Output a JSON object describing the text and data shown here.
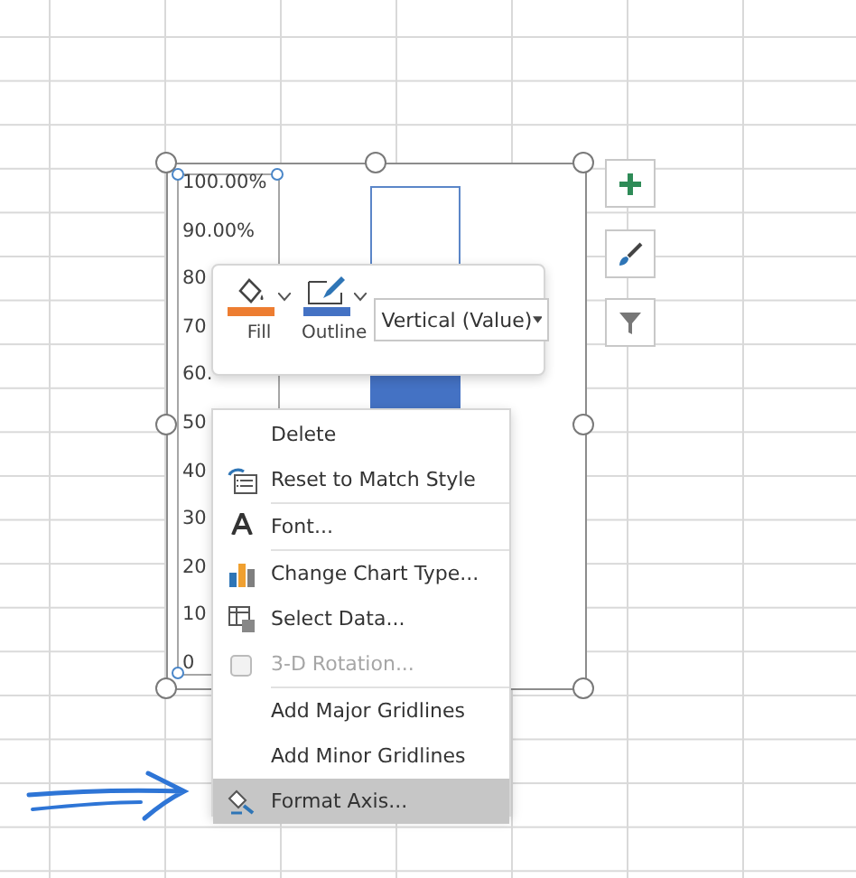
{
  "chart": {
    "axis_labels": [
      {
        "text": "100.00%"
      },
      {
        "text": "90.00%"
      },
      {
        "text": "80"
      },
      {
        "text": "70"
      },
      {
        "text": "60."
      },
      {
        "text": "50"
      },
      {
        "text": "40"
      },
      {
        "text": "30"
      },
      {
        "text": "20"
      },
      {
        "text": "10"
      },
      {
        "text": "0"
      }
    ]
  },
  "mini_toolbar": {
    "buttons": [
      {
        "label": "Fill",
        "color": "#ed7d31"
      },
      {
        "label": "Outline",
        "color": "#4472c4"
      }
    ],
    "dropdown": "Vertical (Value)"
  },
  "context_menu": [
    {
      "label": "Delete",
      "kind": "plain",
      "disabled": false,
      "selected": false,
      "separator_before": false
    },
    {
      "label": "Reset to Match Style",
      "kind": "reset",
      "disabled": false,
      "selected": false,
      "separator_before": false
    },
    {
      "label": "Font...",
      "kind": "font",
      "disabled": false,
      "selected": false,
      "separator_before": true
    },
    {
      "label": "Change Chart Type...",
      "kind": "chart",
      "disabled": false,
      "selected": false,
      "separator_before": true
    },
    {
      "label": "Select Data...",
      "kind": "data",
      "disabled": false,
      "selected": false,
      "separator_before": false
    },
    {
      "label": "3-D Rotation...",
      "kind": "rotation",
      "disabled": true,
      "selected": false,
      "separator_before": false
    },
    {
      "label": "Add Major Gridlines",
      "kind": "plain",
      "disabled": false,
      "selected": false,
      "separator_before": true
    },
    {
      "label": "Add Minor Gridlines",
      "kind": "plain",
      "disabled": false,
      "selected": false,
      "separator_before": false
    },
    {
      "label": "Format Axis...",
      "kind": "format",
      "disabled": false,
      "selected": true,
      "separator_before": false
    }
  ]
}
